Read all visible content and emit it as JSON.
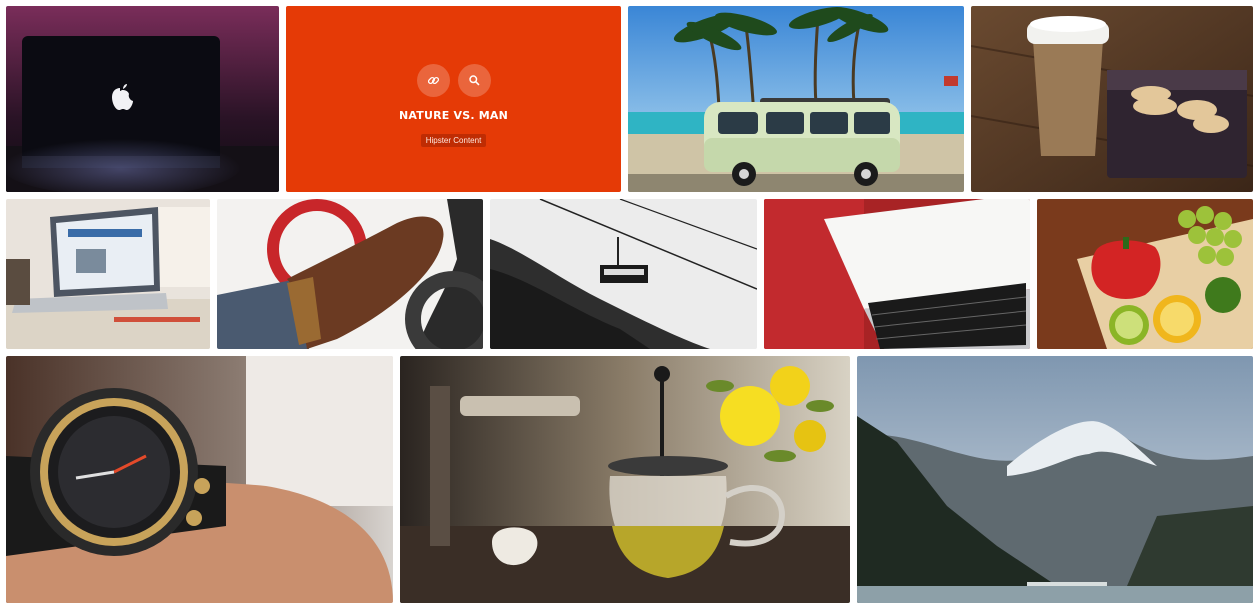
{
  "featured": {
    "title": "NATURE VS. MAN",
    "tag": "Hipster Content",
    "actions": [
      {
        "icon": "link-icon"
      },
      {
        "icon": "search-icon"
      }
    ],
    "accent_color": "#e53a06"
  },
  "gallery": {
    "tiles": [
      {
        "subject": "laptop-apple-logo"
      },
      {
        "subject": "featured-overlay"
      },
      {
        "subject": "vintage-van-beach"
      },
      {
        "subject": "coffee-cup-cookies"
      },
      {
        "subject": "laptop-on-desk"
      },
      {
        "subject": "leather-glove-steering-wheel"
      },
      {
        "subject": "cable-car-hill"
      },
      {
        "subject": "laptop-keyboard-red-blanket"
      },
      {
        "subject": "fruit-on-cutting-board"
      },
      {
        "subject": "wristwatch"
      },
      {
        "subject": "teapot-flowers"
      },
      {
        "subject": "mountain-lake"
      }
    ]
  }
}
